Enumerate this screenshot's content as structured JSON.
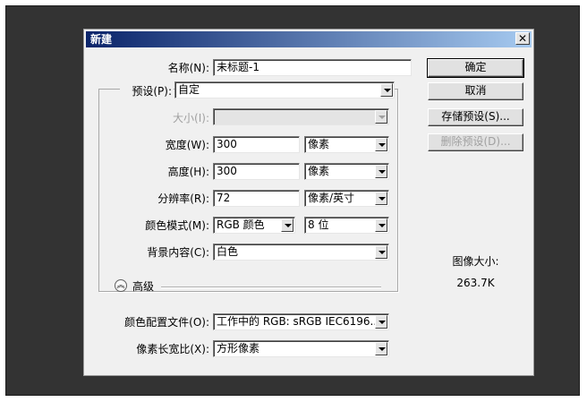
{
  "dialog": {
    "title": "新建",
    "close_glyph": "✕"
  },
  "form": {
    "name_label": "名称(N):",
    "name_value": "未标题-1",
    "preset_label": "预设(P):",
    "preset_value": "自定",
    "size_label": "大小(I):",
    "size_value": "",
    "width_label": "宽度(W):",
    "width_value": "300",
    "width_unit": "像素",
    "height_label": "高度(H):",
    "height_value": "300",
    "height_unit": "像素",
    "resolution_label": "分辨率(R):",
    "resolution_value": "72",
    "resolution_unit": "像素/英寸",
    "color_mode_label": "颜色模式(M):",
    "color_mode_value": "RGB 颜色",
    "bit_depth_value": "8 位",
    "background_label": "背景内容(C):",
    "background_value": "白色",
    "advanced_label": "高级",
    "advanced_icon": "chevron-up-icon",
    "color_profile_label": "颜色配置文件(O):",
    "color_profile_value": "工作中的 RGB: sRGB IEC6196...",
    "pixel_aspect_label": "像素长宽比(X):",
    "pixel_aspect_value": "方形像素"
  },
  "buttons": {
    "ok": "确定",
    "cancel": "取消",
    "save_preset": "存储预设(S)...",
    "delete_preset": "删除预设(D)..."
  },
  "info": {
    "image_size_label": "图像大小:",
    "image_size_value": "263.7K"
  }
}
